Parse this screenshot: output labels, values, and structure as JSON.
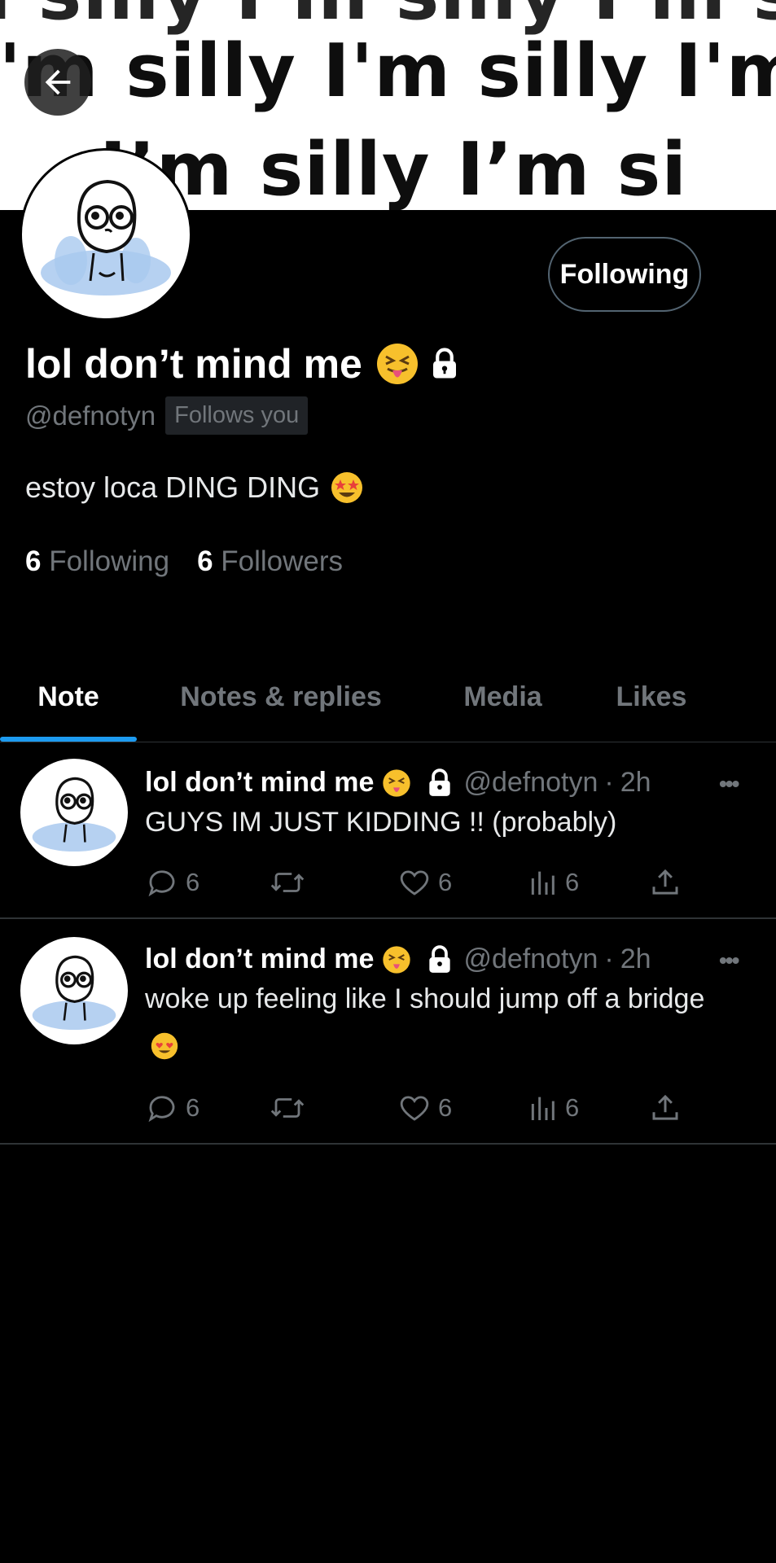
{
  "banner": {
    "repeat_text": "I'm silly I'm silly I'm silly I'm silly"
  },
  "profile": {
    "display_name": "lol don’t mind me",
    "handle": "@defnotyn",
    "follows_you": "Follows you",
    "follow_button": "Following",
    "bio": "estoy loca DING DING",
    "following_count": "6",
    "following_label": "Following",
    "followers_count": "6",
    "followers_label": "Followers"
  },
  "tabs": [
    {
      "label": "Note",
      "active": true
    },
    {
      "label": "Notes & replies",
      "active": false
    },
    {
      "label": "Media",
      "active": false
    },
    {
      "label": "Likes",
      "active": false
    }
  ],
  "posts": [
    {
      "name": "lol don’t mind me",
      "handle": "@defnotyn",
      "time": "2h",
      "text": "GUYS IM JUST KIDDING !! (probably)",
      "replies": "6",
      "likes": "6",
      "views": "6"
    },
    {
      "name": "lol don’t mind me",
      "handle": "@defnotyn",
      "time": "2h",
      "text": "woke up feeling like I should jump off a bridge",
      "replies": "6",
      "likes": "6",
      "views": "6"
    }
  ],
  "colors": {
    "accent": "#1d9bf0",
    "background": "#000000",
    "muted": "#71767b",
    "divider": "#2f3336"
  },
  "icons": [
    "back-arrow-icon",
    "lock-icon",
    "reply-icon",
    "retweet-icon",
    "like-icon",
    "views-icon",
    "share-icon",
    "more-icon"
  ]
}
